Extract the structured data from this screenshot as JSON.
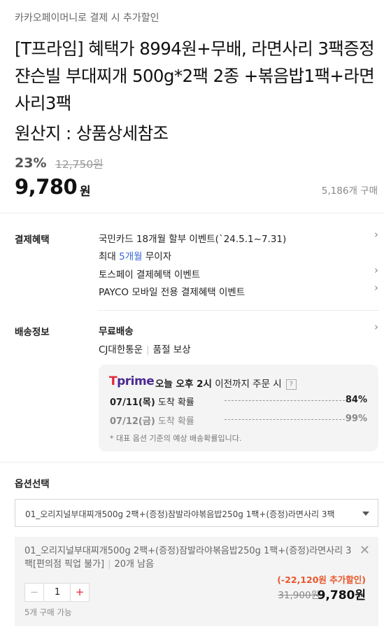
{
  "promo_text": "카카오페이머니로 결제 시 추가할인",
  "product": {
    "title": "[T프라임] 혜택가 8994원+무배, 라면사리 3팩증정 쟌슨빌 부대찌개 500g*2팩 2종 +볶음밥1팩+라면사리3팩",
    "origin": "원산지 : 상품상세참조",
    "discount_rate": "23%",
    "original_price": "12,750원",
    "price": "9,780",
    "price_unit": "원",
    "sales_count": "5,186개 구매"
  },
  "payment": {
    "label": "결제혜택",
    "items": [
      {
        "text": "국민카드 18개월 할부 이벤트(`24.5.1~7.31)"
      },
      {
        "prefix": "최대 ",
        "highlight": "5개월",
        "suffix": " 무이자"
      },
      {
        "text": "토스페이 결제혜택 이벤트"
      },
      {
        "text": "PAYCO 모바일 전용 결제혜택 이벤트"
      }
    ]
  },
  "shipping": {
    "label": "배송정보",
    "free": "무료배송",
    "carrier": "CJ대한통운",
    "guarantee": "품절 보상",
    "tprime": {
      "logo_t": "T",
      "logo_prime": "prime",
      "msg_prefix": "오늘 오후 2시",
      "msg_suffix": " 이전까지 주문 시",
      "help_icon": "?",
      "rows": [
        {
          "date": "07/11(목)",
          "label": "도착 확률",
          "pct": "84%"
        },
        {
          "date": "07/12(금)",
          "label": "도착 확률",
          "pct": "99%"
        }
      ],
      "note": "* 대표 옵션 기준의 예상 배송확률입니다."
    }
  },
  "options": {
    "title": "옵션선택",
    "selected": "01_오리지널부대찌개500g 2팩+(증정)잠발라야볶음밥250g 1팩+(증정)라면사리 3팩"
  },
  "cart_item": {
    "name": "01_오리지널부대찌개500g 2팩+(증정)잠발라야볶음밥250g 1팩+(증정)라면사리 3팩[편의점 픽업 불가]",
    "stock": "20개 남음",
    "minus": "−",
    "qty": "1",
    "plus": "+",
    "limit": "5개 구매 가능",
    "extra_discount": "(-22,120원 추가할인)",
    "original_price": "31,900원",
    "final_price": "9,780원",
    "close": "✕"
  },
  "icons": {
    "chevron": "›"
  },
  "colors": {
    "tprime_red": "#e8233a",
    "tprime_purple": "#4b2a91",
    "accent_blue": "#3868d8",
    "discount_orange": "#e8572a"
  }
}
